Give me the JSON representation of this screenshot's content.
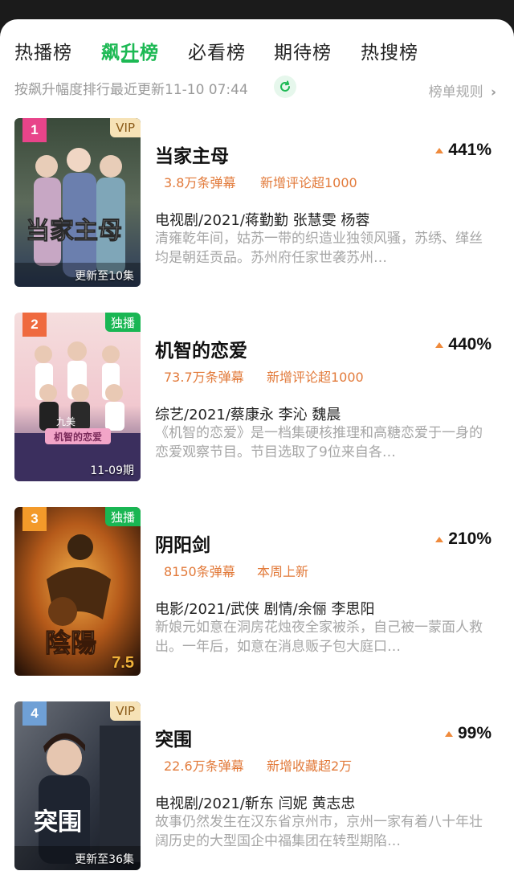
{
  "tabs": [
    "热播榜",
    "飙升榜",
    "必看榜",
    "期待榜",
    "热搜榜"
  ],
  "active_tab": 1,
  "subtitle": {
    "update_text": "按飙升幅度排行最近更新11-10 07:44",
    "rules_label": "榜单规则"
  },
  "colors": {
    "accent": "#1db954",
    "stat_text": "#e27a3a",
    "rise_arrow": "#ef8a3c",
    "rank_1": "#e8448a",
    "rank_2": "#ef6a3f",
    "rank_3": "#f39a2a",
    "rank_4": "#6fa0d6"
  },
  "items": [
    {
      "rank": "1",
      "tag": "VIP",
      "poster_caption": "更新至10集",
      "poster_art_text": "当家主母",
      "title": "当家主母",
      "rise": "441%",
      "stat1": "3.8万条弹幕",
      "stat2": "新增评论超1000",
      "meta": "电视剧/2021/蒋勤勤 张慧雯 杨蓉",
      "desc": "清雍乾年间，姑苏一带的织造业独领风骚，苏绣、缂丝均是朝廷贡品。苏州府任家世袭苏州…"
    },
    {
      "rank": "2",
      "tag": "独播",
      "poster_caption": "11-09期",
      "poster_art_text": "机智的恋爱",
      "poster_art_small": "九美",
      "title": "机智的恋爱",
      "rise": "440%",
      "stat1": "73.7万条弹幕",
      "stat2": "新增评论超1000",
      "meta": "综艺/2021/蔡康永 李沁 魏晨",
      "desc": "《机智的恋爱》是一档集硬核推理和高糖恋爱于一身的恋爱观察节目。节目选取了9位来自各…"
    },
    {
      "rank": "3",
      "tag": "独播",
      "poster_score": "7.5",
      "poster_art_text": "陰陽",
      "title": "阴阳剑",
      "rise": "210%",
      "stat1": "8150条弹幕",
      "stat2": "本周上新",
      "meta": "电影/2021/武侠 剧情/余俪 李思阳",
      "desc": "新娘元如意在洞房花烛夜全家被杀，自己被一蒙面人救出。一年后，如意在消息贩子包大庭口…"
    },
    {
      "rank": "4",
      "tag": "VIP",
      "poster_caption": "更新至36集",
      "poster_art_text": "突围",
      "title": "突围",
      "rise": "99%",
      "stat1": "22.6万条弹幕",
      "stat2": "新增收藏超2万",
      "meta": "电视剧/2021/靳东 闫妮 黄志忠",
      "desc": "故事仍然发生在汉东省京州市，京州一家有着八十年壮阔历史的大型国企中福集团在转型期陷…"
    }
  ]
}
